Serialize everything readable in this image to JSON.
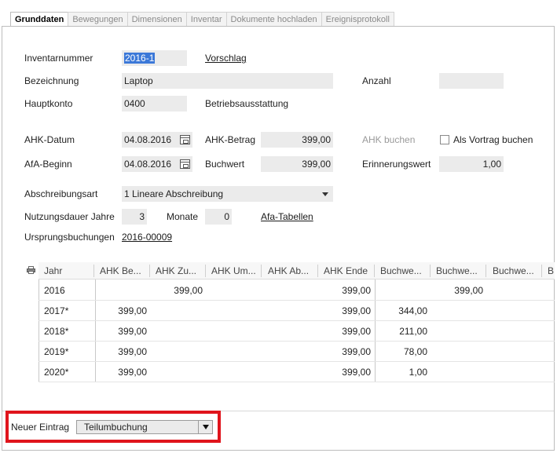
{
  "tabs": [
    {
      "label": "Grunddaten",
      "active": true
    },
    {
      "label": "Bewegungen",
      "active": false
    },
    {
      "label": "Dimensionen",
      "active": false
    },
    {
      "label": "Inventar",
      "active": false
    },
    {
      "label": "Dokumente hochladen",
      "active": false
    },
    {
      "label": "Ereignisprotokoll",
      "active": false
    }
  ],
  "form": {
    "inventarnummer_label": "Inventarnummer",
    "inventarnummer_value": "2016-1",
    "vorschlag_link": "Vorschlag",
    "bezeichnung_label": "Bezeichnung",
    "bezeichnung_value": "Laptop",
    "anzahl_label": "Anzahl",
    "anzahl_value": "",
    "hauptkonto_label": "Hauptkonto",
    "hauptkonto_value": "0400",
    "hauptkonto_desc": "Betriebsausstattung",
    "ahk_datum_label": "AHK-Datum",
    "ahk_datum_value": "04.08.2016",
    "ahk_betrag_label": "AHK-Betrag",
    "ahk_betrag_value": "399,00",
    "ahk_buchen_label": "AHK buchen",
    "als_vortrag_label": "Als Vortrag buchen",
    "afa_beginn_label": "AfA-Beginn",
    "afa_beginn_value": "04.08.2016",
    "buchwert_label": "Buchwert",
    "buchwert_value": "399,00",
    "erinnerungswert_label": "Erinnerungswert",
    "erinnerungswert_value": "1,00",
    "abschreibungsart_label": "Abschreibungsart",
    "abschreibungsart_value": "1 Lineare Abschreibung",
    "nutzungsdauer_label": "Nutzungsdauer Jahre",
    "nutzungsdauer_value": "3",
    "monate_label": "Monate",
    "monate_value": "0",
    "afa_tabellen_link": "Afa-Tabellen",
    "ursprungsbuchungen_label": "Ursprungsbuchungen",
    "ursprungsbuchungen_link": "2016-00009"
  },
  "table": {
    "columns": [
      "Jahr",
      "AHK Be...",
      "AHK Zu...",
      "AHK Um...",
      "AHK Ab...",
      "AHK Ende",
      "Buchwe...",
      "Buchwe...",
      "Buchwe...",
      "B"
    ],
    "rows": [
      {
        "jahr": "2016",
        "ahk_beginn": "",
        "ahk_zugang": "399,00",
        "ahk_ende": "399,00",
        "buchwert_beginn": "",
        "buchwert_2": "399,00"
      },
      {
        "jahr": "2017*",
        "ahk_beginn": "399,00",
        "ahk_zugang": "",
        "ahk_ende": "399,00",
        "buchwert_beginn": "344,00",
        "buchwert_2": ""
      },
      {
        "jahr": "2018*",
        "ahk_beginn": "399,00",
        "ahk_zugang": "",
        "ahk_ende": "399,00",
        "buchwert_beginn": "211,00",
        "buchwert_2": ""
      },
      {
        "jahr": "2019*",
        "ahk_beginn": "399,00",
        "ahk_zugang": "",
        "ahk_ende": "399,00",
        "buchwert_beginn": "78,00",
        "buchwert_2": ""
      },
      {
        "jahr": "2020*",
        "ahk_beginn": "399,00",
        "ahk_zugang": "",
        "ahk_ende": "399,00",
        "buchwert_beginn": "1,00",
        "buchwert_2": ""
      }
    ]
  },
  "footer": {
    "neuer_eintrag_label": "Neuer Eintrag",
    "neuer_eintrag_value": "Teilumbuchung"
  },
  "icons": {
    "calendar": "calendar-icon",
    "printer": "printer-icon",
    "dropdown": "chevron-down-icon"
  },
  "colors": {
    "highlight_border": "#e0141c",
    "selection": "#3b78d8",
    "field_bg": "#ebebeb"
  }
}
